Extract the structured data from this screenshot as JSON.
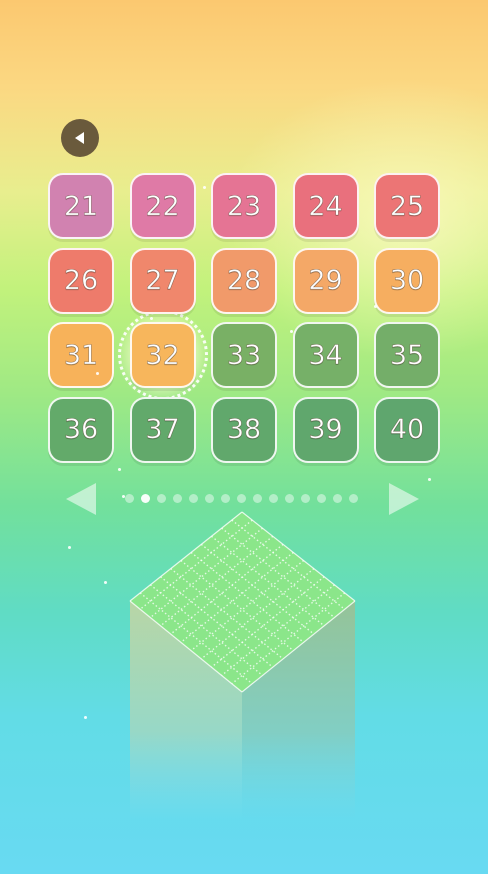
{
  "colors": {
    "back_button": "#6a5a3c",
    "cube_top": "#8be68a",
    "cube_left": "#b8d6a8",
    "cube_right": "#9cc39a"
  },
  "back_button": {
    "icon": "back-triangle-icon"
  },
  "levels": [
    {
      "label": "21",
      "color": "#d182b0"
    },
    {
      "label": "22",
      "color": "#df7aa6"
    },
    {
      "label": "23",
      "color": "#e57494"
    },
    {
      "label": "24",
      "color": "#e9707d"
    },
    {
      "label": "25",
      "color": "#ec7575"
    },
    {
      "label": "26",
      "color": "#ee7b6b"
    },
    {
      "label": "27",
      "color": "#f0876c"
    },
    {
      "label": "28",
      "color": "#f19a6a"
    },
    {
      "label": "29",
      "color": "#f4a867"
    },
    {
      "label": "30",
      "color": "#f6ae60"
    },
    {
      "label": "31",
      "color": "#f7b25a"
    },
    {
      "label": "32",
      "color": "#f7b65c",
      "current": true
    },
    {
      "label": "33",
      "color": "#79b065"
    },
    {
      "label": "34",
      "color": "#76b068"
    },
    {
      "label": "35",
      "color": "#74ae69"
    },
    {
      "label": "36",
      "color": "#63aa6a"
    },
    {
      "label": "37",
      "color": "#62a96b"
    },
    {
      "label": "38",
      "color": "#61a86c"
    },
    {
      "label": "39",
      "color": "#60a76d"
    },
    {
      "label": "40",
      "color": "#5fa66e"
    }
  ],
  "pager": {
    "prev_icon": "previous-arrow-icon",
    "next_icon": "next-arrow-icon",
    "page_count": 15,
    "current_page": 2
  }
}
